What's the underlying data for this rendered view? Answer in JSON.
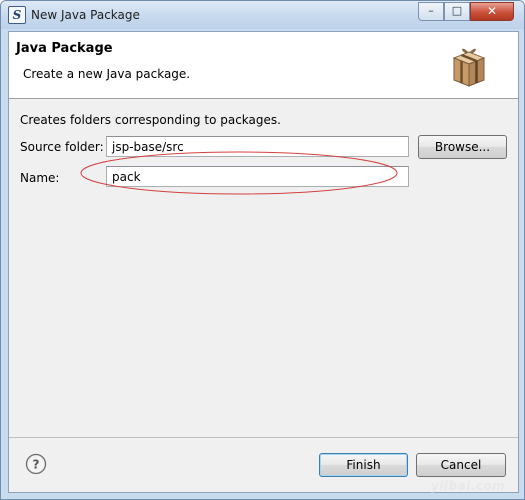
{
  "window": {
    "title": "New Java Package",
    "app_icon": "eclipse-icon",
    "controls": {
      "minimize": "–",
      "maximize": "□",
      "close": "✕"
    }
  },
  "banner": {
    "title": "Java Package",
    "description": "Create a new Java package.",
    "icon": "package-icon"
  },
  "form": {
    "info": "Creates folders corresponding to packages.",
    "source_folder_label": "Source folder:",
    "source_folder_value": "jsp-base/src",
    "browse_label": "Browse...",
    "name_label": "Name:",
    "name_value": "pack"
  },
  "footer": {
    "help_icon": "help-icon",
    "finish_label": "Finish",
    "cancel_label": "Cancel"
  },
  "watermark": "yiibai.com",
  "colors": {
    "annotation": "#d44040",
    "default_button_border": "#3c7fb1",
    "titlebar": "#c7d9ee"
  }
}
